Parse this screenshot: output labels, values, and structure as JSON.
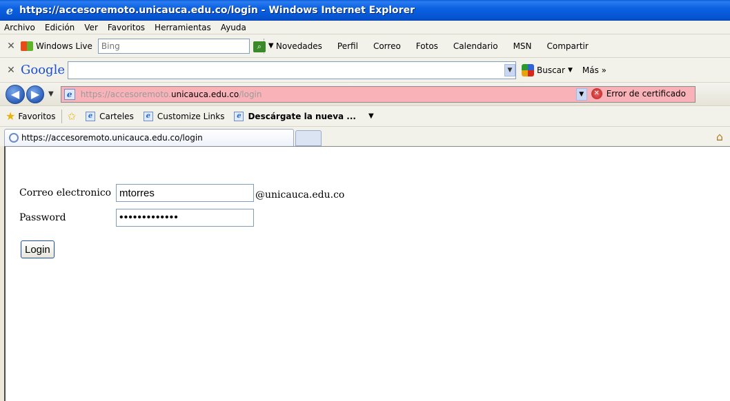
{
  "window": {
    "title": "https://accesoremoto.unicauca.edu.co/login - Windows Internet Explorer"
  },
  "menu": [
    "Archivo",
    "Edición",
    "Ver",
    "Favoritos",
    "Herramientas",
    "Ayuda"
  ],
  "windows_live": {
    "label": "Windows Live",
    "search_placeholder": "Bing",
    "links": [
      "Novedades",
      "Perfil",
      "Correo",
      "Fotos",
      "Calendario",
      "MSN",
      "Compartir"
    ]
  },
  "google": {
    "logo": "Google",
    "search_value": "",
    "buscar_label": "Buscar",
    "mas_label": "Más »"
  },
  "address": {
    "url_prefix": "https://accesoremoto.",
    "url_host": "unicauca.edu.co",
    "url_path": "/login",
    "cert_error": "Error de certificado"
  },
  "favorites": {
    "label": "Favoritos",
    "links": [
      "Carteles",
      "Customize Links",
      "Descárgate la nueva ..."
    ]
  },
  "tab": {
    "label": "https://accesoremoto.unicauca.edu.co/login"
  },
  "form": {
    "email_label": "Correo electronico",
    "email_value": "mtorres",
    "domain_suffix": "@unicauca.edu.co",
    "password_label": "Password",
    "password_value": "•••••••••••••",
    "login_button": "Login"
  },
  "colors": {
    "title_bar": "#0553d0",
    "cert_error_bg": "#f8b2b8"
  }
}
